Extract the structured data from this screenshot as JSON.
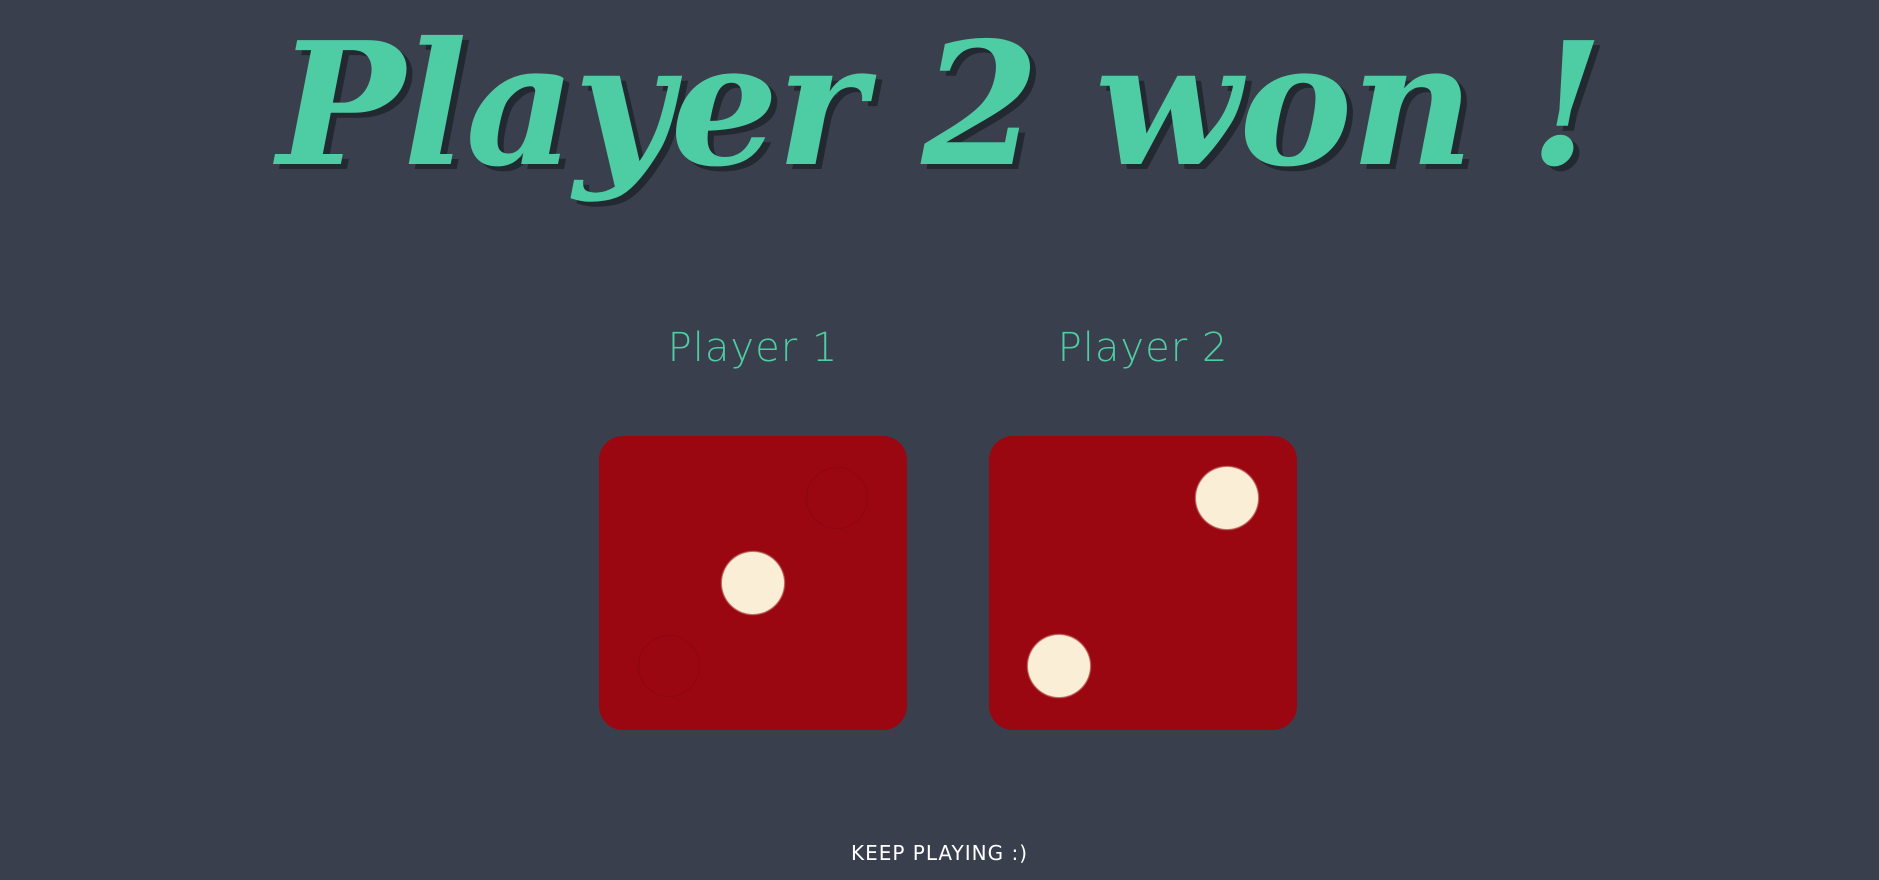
{
  "game": {
    "title": "Player 2 won !",
    "footer_text": "KEEP PLAYING :)"
  },
  "players": [
    {
      "label": "Player 1",
      "die_value": 1
    },
    {
      "label": "Player 2",
      "die_value": 2
    }
  ],
  "colors": {
    "background": "#393f4d",
    "accent": "#4ecca3",
    "die": "#9a0710",
    "pip": "#fbeed7"
  }
}
